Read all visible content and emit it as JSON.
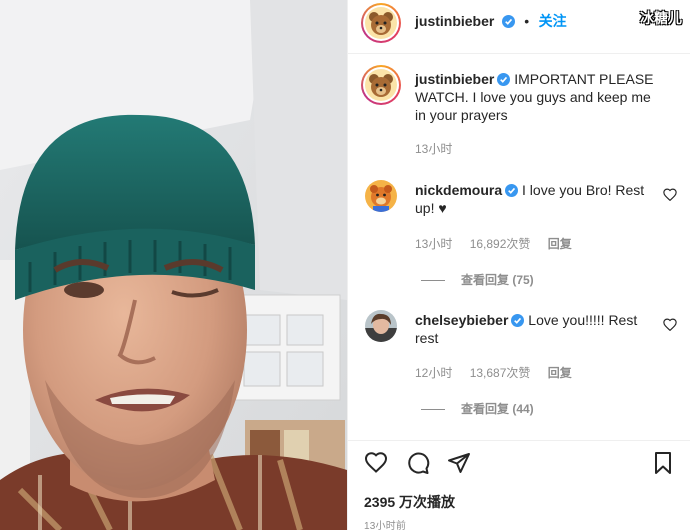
{
  "media": {
    "description_icon": "video-still"
  },
  "header": {
    "username": "justinbieber",
    "separator": "•",
    "follow_label": "关注"
  },
  "watermark": "冰糖儿",
  "caption": {
    "username": "justinbieber",
    "text": "IMPORTANT PLEASE WATCH. I love you guys and keep me in your prayers",
    "time": "13小时"
  },
  "comments": [
    {
      "username": "nickdemoura",
      "text": "I love you Bro! Rest up! ♥",
      "time": "13小时",
      "likes": "16,892次赞",
      "reply_label": "回复",
      "view_replies": "查看回复 (75)"
    },
    {
      "username": "chelseybieber",
      "text": "Love you!!!!! Rest rest",
      "time": "12小时",
      "likes": "13,687次赞",
      "reply_label": "回复",
      "view_replies": "查看回复 (44)"
    }
  ],
  "footer": {
    "views": "2395 万次播放",
    "time": "13小时前"
  },
  "colors": {
    "accent": "#0095f6",
    "verified": "#3897f0",
    "muted": "#8e8e8e",
    "text": "#262626",
    "beanie": "#1f6f6b"
  },
  "icons": [
    "heart-icon",
    "comment-icon",
    "share-icon",
    "bookmark-icon",
    "verified-badge-icon",
    "like-heart-icon"
  ]
}
